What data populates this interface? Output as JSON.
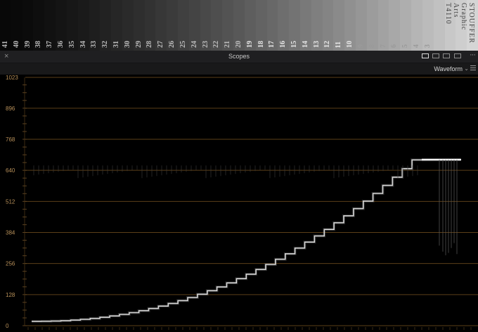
{
  "wedge": {
    "steps": [
      "41",
      "40",
      "39",
      "38",
      "37",
      "36",
      "35",
      "34",
      "33",
      "32",
      "31",
      "30",
      "29",
      "28",
      "27",
      "26",
      "25",
      "24",
      "23",
      "22",
      "21",
      "20",
      "19",
      "18",
      "17",
      "16",
      "15",
      "14",
      "13",
      "12",
      "11",
      "10",
      "9",
      "8",
      "7",
      "6",
      "5",
      "4",
      "3"
    ],
    "brand_lines": [
      "STOUFFER",
      "Graphic Arts",
      "T4110"
    ]
  },
  "panel": {
    "close_glyph": "×",
    "title": "Scopes",
    "more_glyph": "···",
    "mode_label": "Waveform",
    "mode_caret": "⌄"
  },
  "scope": {
    "y_ticks": [
      "1023",
      "896",
      "768",
      "640",
      "512",
      "384",
      "256",
      "128",
      "0"
    ],
    "y_values": [
      1023,
      896,
      768,
      640,
      512,
      384,
      256,
      128,
      0
    ],
    "grid_color": "#6b4a1e",
    "label_color": "#b9915a"
  }
}
